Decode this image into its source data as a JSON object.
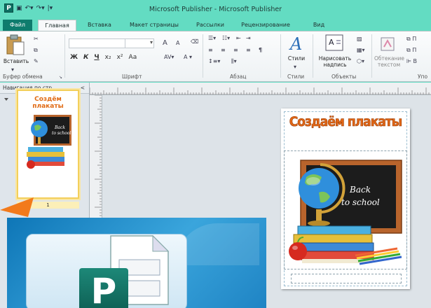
{
  "window": {
    "title": "Microsoft Publisher - Microsoft Publisher",
    "logo_letter": "P"
  },
  "tabs": [
    {
      "label": "Файл"
    },
    {
      "label": "Главная"
    },
    {
      "label": "Вставка"
    },
    {
      "label": "Макет страницы"
    },
    {
      "label": "Рассылки"
    },
    {
      "label": "Рецензирование"
    },
    {
      "label": "Вид"
    }
  ],
  "ribbon": {
    "clipboard": {
      "paste_label": "Вставить",
      "group_label": "Буфер обмена"
    },
    "font": {
      "group_label": "Шрифт",
      "format_buttons": [
        "Ж",
        "К",
        "Ч",
        "x₂",
        "x²",
        "Aa"
      ],
      "grow": "A",
      "shrink": "A"
    },
    "paragraph": {
      "group_label": "Абзац",
      "para_mark": "¶"
    },
    "styles": {
      "button_label": "Стили",
      "group_label": "Стили"
    },
    "objects": {
      "draw_textbox_label": "Нарисовать надпись",
      "group_label": "Объекты"
    },
    "arrange": {
      "wrap_label": "Обтекание текстом",
      "group_label": "Упо"
    }
  },
  "navigation": {
    "header": "Навигация по стр...",
    "collapse": "<",
    "page_number": "1",
    "thumb_title": "Создём плакаты"
  },
  "poster": {
    "title": "Создаём плакаты",
    "board_text_line1": "Back",
    "board_text_line2": "to school"
  },
  "colors": {
    "accent": "#0e7c6d",
    "title_orange": "#e26716",
    "chalkboard": "#1c1c1c",
    "frame": "#b8642c"
  }
}
